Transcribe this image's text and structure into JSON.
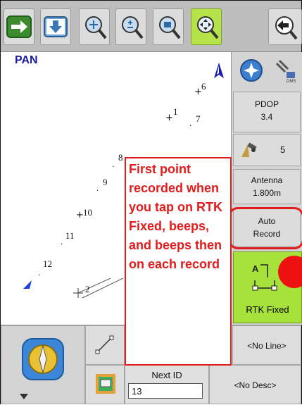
{
  "map": {
    "mode_label": "PAN",
    "points": [
      "1",
      "2",
      "6",
      "7",
      "8",
      "9",
      "10",
      "11",
      "12"
    ]
  },
  "right_panel": {
    "pdop_label": "PDOP",
    "pdop_value": "3.4",
    "satellites_count": "5",
    "antenna_label": "Antenna",
    "antenna_value": "1.800m",
    "auto_record_line1": "Auto",
    "auto_record_line2": "Record",
    "rtk_status": "RTK Fixed"
  },
  "annotation": {
    "text": "First point recorded when you tap on RTK Fixed, beeps, and beeps then on each record"
  },
  "bottom": {
    "line_value": "<No Line>",
    "next_id_label": "Next ID",
    "next_id_value": "13",
    "desc_value": "<No Desc>"
  },
  "colors": {
    "active_green": "#a6e23a",
    "annotation_red": "#e21b1b",
    "pan_blue": "#1a1aa0"
  },
  "icons": [
    "forward-arrow-icon",
    "download-icon",
    "zoom-extents-icon",
    "zoom-in-out-icon",
    "zoom-window-icon",
    "pan-icon",
    "back-arrow-icon",
    "north-arrow-icon",
    "compass-icon",
    "satellite-icon",
    "gps-receiver-icon",
    "line-tool-icon",
    "code-list-icon"
  ]
}
